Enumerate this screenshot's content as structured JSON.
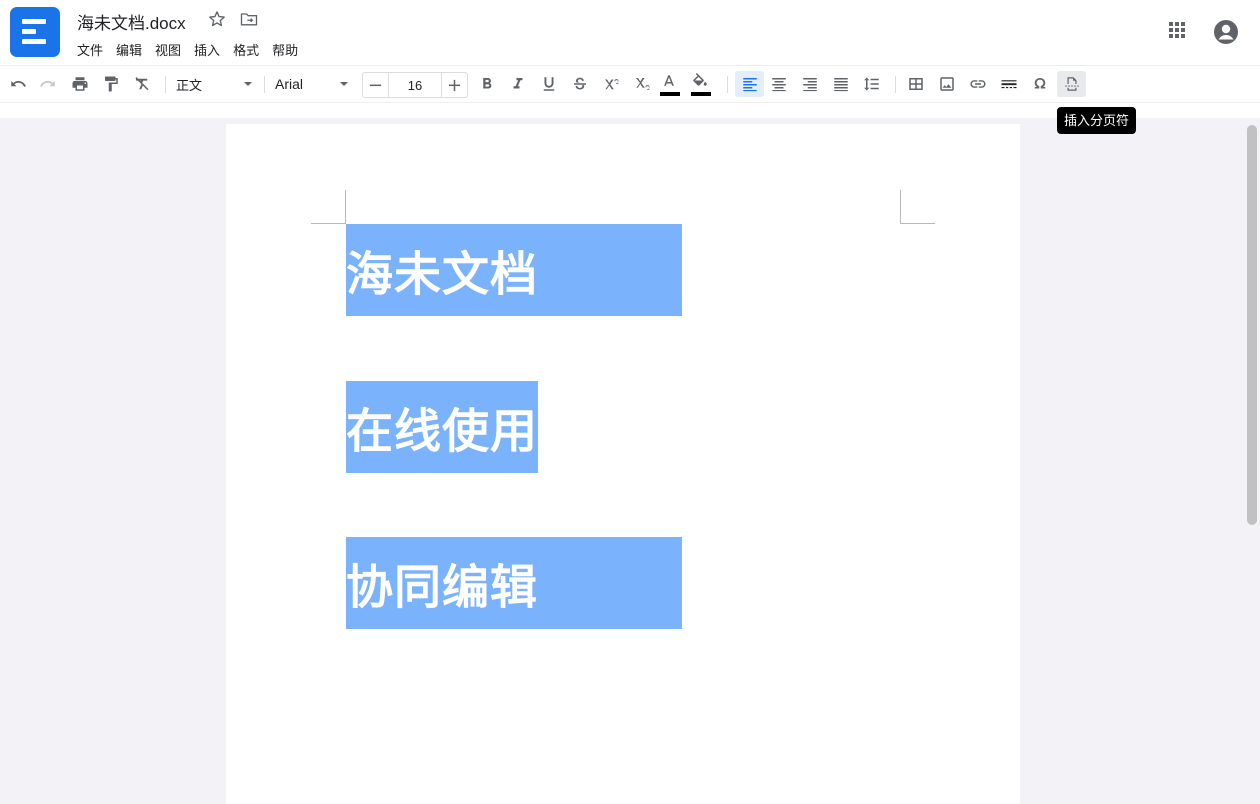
{
  "header": {
    "title": "海未文档.docx",
    "menu": [
      "文件",
      "编辑",
      "视图",
      "插入",
      "格式",
      "帮助"
    ]
  },
  "toolbar": {
    "paragraph_style": "正文",
    "font_family": "Arial",
    "font_size": "16",
    "tooltip": "插入分页符"
  },
  "document": {
    "paragraphs": [
      "海未文档",
      "在线使用",
      "协同编辑"
    ]
  },
  "colors": {
    "brand": "#1a73e8",
    "highlight": "#7ab2fb"
  }
}
